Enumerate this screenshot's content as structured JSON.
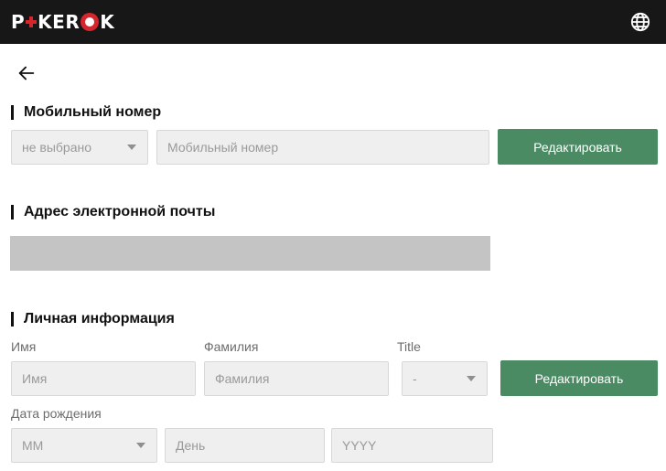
{
  "header": {
    "logo_text": "POKEROK",
    "logo_parts": {
      "p": "P",
      "mid": "KER",
      "k": "K"
    },
    "globe_icon": "globe-icon",
    "background_color": "#171717",
    "brand_red": "#d4262c"
  },
  "nav": {
    "back_icon": "arrow-left-icon"
  },
  "mobile": {
    "title": "Мобильный номер",
    "country_select_value": "не выбрано",
    "phone_placeholder": "Мобильный номер",
    "edit_button": "Редактировать"
  },
  "email": {
    "title": "Адрес электронной почты"
  },
  "personal": {
    "title": "Личная информация",
    "first_name_label": "Имя",
    "first_name_placeholder": "Имя",
    "last_name_label": "Фамилия",
    "last_name_placeholder": "Фамилия",
    "title_label": "Title",
    "title_select_value": "-",
    "edit_button": "Редактировать",
    "dob_label": "Дата рождения",
    "dob_month_value": "MM",
    "dob_day_placeholder": "День",
    "dob_year_placeholder": "YYYY"
  },
  "colors": {
    "button_green": "#4a8b63",
    "field_bg": "#efefef",
    "disabled_bar": "#c4c4c4"
  }
}
